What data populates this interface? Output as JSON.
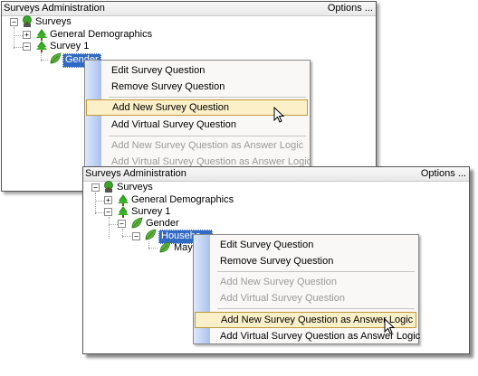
{
  "back": {
    "title": "Surveys Administration",
    "options": "Options ...",
    "tree": {
      "root": "Surveys",
      "general": "General Demographics",
      "survey": "Survey 1",
      "selected_node": "Gender"
    },
    "menu": {
      "edit": "Edit Survey Question",
      "remove": "Remove Survey Question",
      "add_new": "Add New Survey Question",
      "add_virtual": "Add Virtual Survey Question",
      "add_new_logic": "Add New Survey Question as Answer Logic",
      "add_virtual_logic": "Add Virtual Survey Question as Answer Logic"
    }
  },
  "front": {
    "title": "Surveys Administration",
    "options": "Options ...",
    "tree": {
      "root": "Surveys",
      "general": "General Demographics",
      "survey": "Survey 1",
      "gender": "Gender",
      "selected_node": "Househo",
      "child": "May"
    },
    "menu": {
      "edit": "Edit Survey Question",
      "remove": "Remove Survey Question",
      "add_new": "Add New Survey Question",
      "add_virtual": "Add Virtual Survey Question",
      "add_new_logic": "Add New Survey Question as Answer Logic",
      "add_virtual_logic": "Add Virtual Survey Question as Answer Logic"
    }
  },
  "colors": {
    "selection": "#316ac5",
    "menu_hover_bg": "#fbf0c8",
    "menu_hover_border": "#c19a3c",
    "menu_stripe": "#a9c1ee",
    "leaf_green": "#2e9a1e"
  },
  "icons": {
    "root": "survey-tree-icon",
    "node": "green-tree-icon",
    "question": "leaf-icon",
    "expand": "plus-box",
    "collapse": "minus-box",
    "pointer": "arrow-cursor"
  }
}
